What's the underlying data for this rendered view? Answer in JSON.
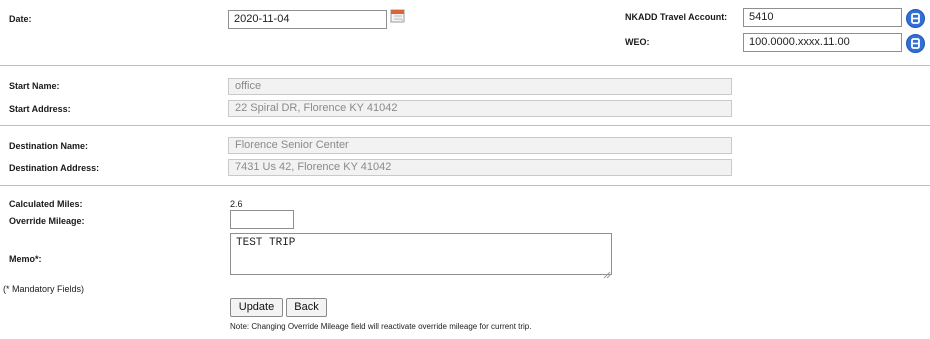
{
  "labels": {
    "date": "Date:",
    "travel_account": "NKADD Travel Account:",
    "weo": "WEO:",
    "start_name": "Start Name:",
    "start_address": "Start Address:",
    "destination_name": "Destination Name:",
    "destination_address": "Destination Address:",
    "calculated_miles": "Calculated Miles:",
    "override_mileage": "Override Mileage:",
    "memo": "Memo*:",
    "mandatory": "(* Mandatory Fields)"
  },
  "values": {
    "date": "2020-11-04",
    "travel_account": "5410",
    "weo": "100.0000.xxxx.11.00",
    "start_name": "office",
    "start_address": "22 Spiral DR, Florence KY 41042",
    "destination_name": "Florence Senior Center",
    "destination_address": "7431 Us 42, Florence KY 41042",
    "calculated_miles": "2.6",
    "override_mileage": "",
    "memo": "TEST TRIP"
  },
  "buttons": {
    "update": "Update",
    "back": "Back"
  },
  "note": "Note: Changing Override Mileage field will reactivate override mileage for current trip.",
  "icons": {
    "calendar": "calendar-icon",
    "lookup": "lookup-icon"
  },
  "colors": {
    "lookup_blue": "#2f6fd6",
    "readonly_bg": "#f2f2f2"
  }
}
